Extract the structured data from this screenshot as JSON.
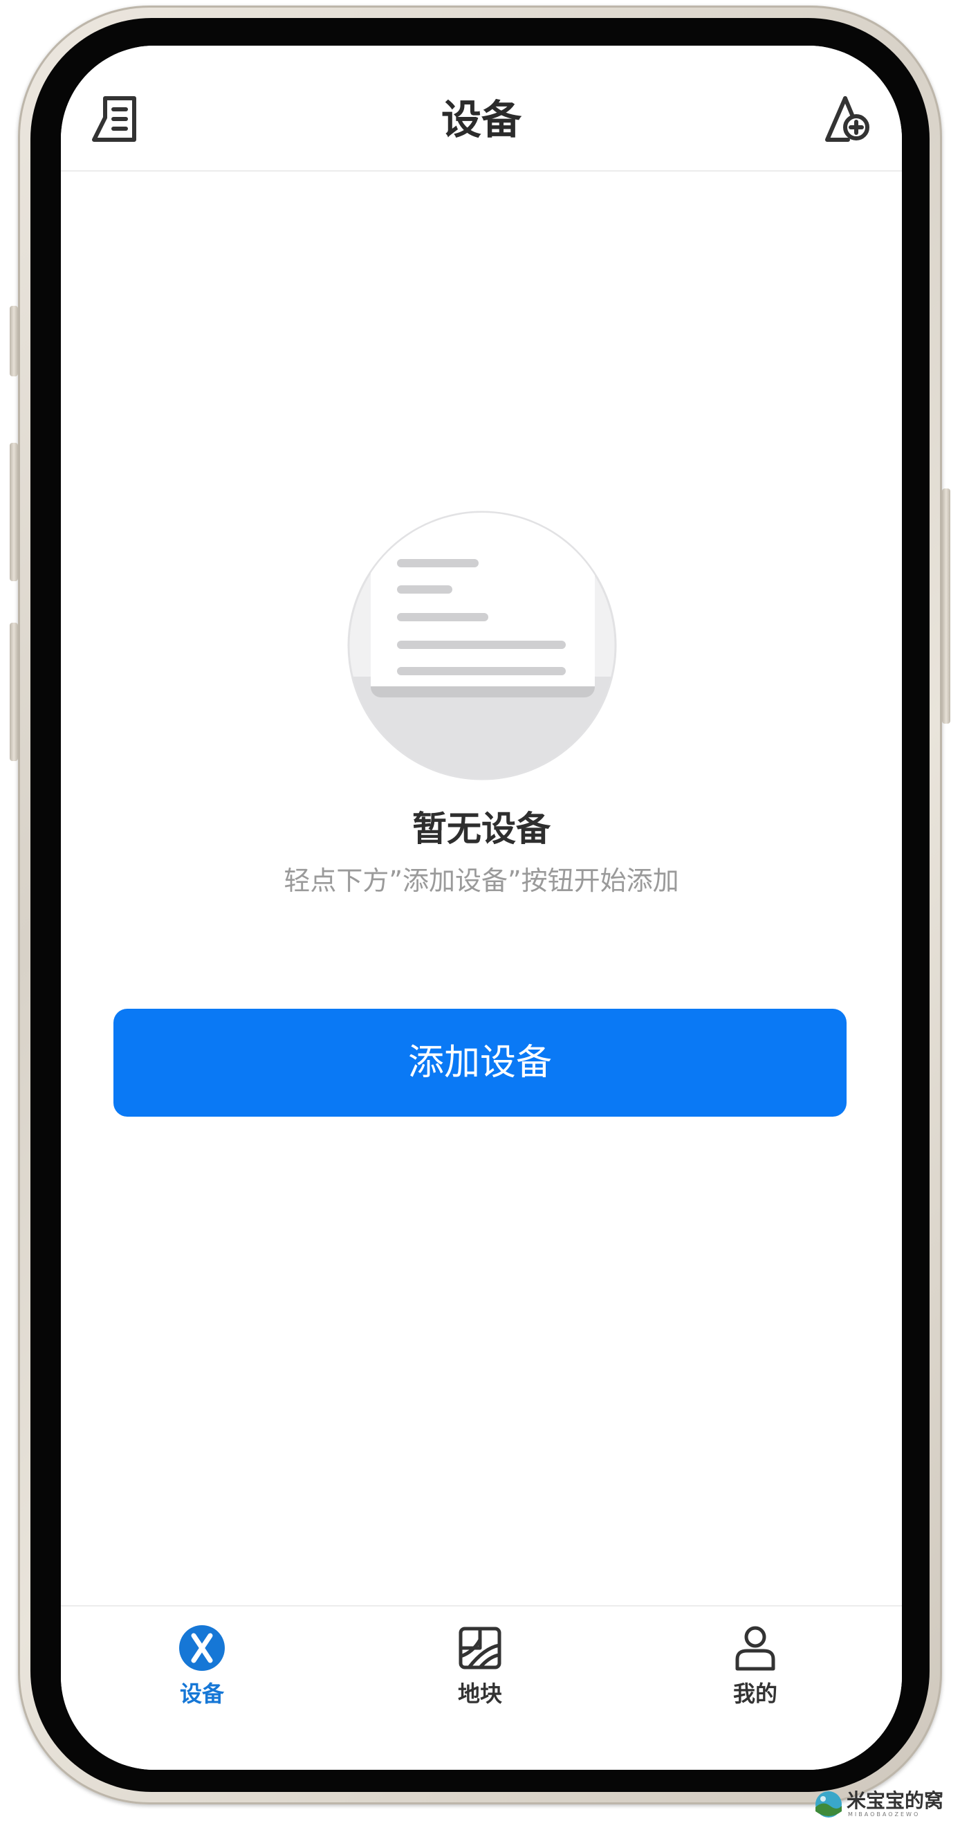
{
  "header": {
    "title": "设备",
    "left_icon": "document-list-icon",
    "right_icon": "add-location-icon"
  },
  "empty_state": {
    "illustration": "empty-document-illustration",
    "title": "暂无设备",
    "subtitle": "轻点下方”添加设备”按钮开始添加"
  },
  "actions": {
    "add_device_label": "添加设备"
  },
  "tabs": [
    {
      "label": "设备",
      "icon": "device-x-icon",
      "active": true
    },
    {
      "label": "地块",
      "icon": "land-parcel-icon",
      "active": false
    },
    {
      "label": "我的",
      "icon": "profile-icon",
      "active": false
    }
  ],
  "watermark": {
    "text": "米宝宝的窝",
    "small_text": "MIBAOBAOZEWO"
  },
  "colors": {
    "accent": "#0A79F5",
    "tab_active": "#1677D6",
    "title_text": "#2B2B2B",
    "subtitle_text": "#9A9A9A",
    "icon_stroke": "#333333"
  }
}
